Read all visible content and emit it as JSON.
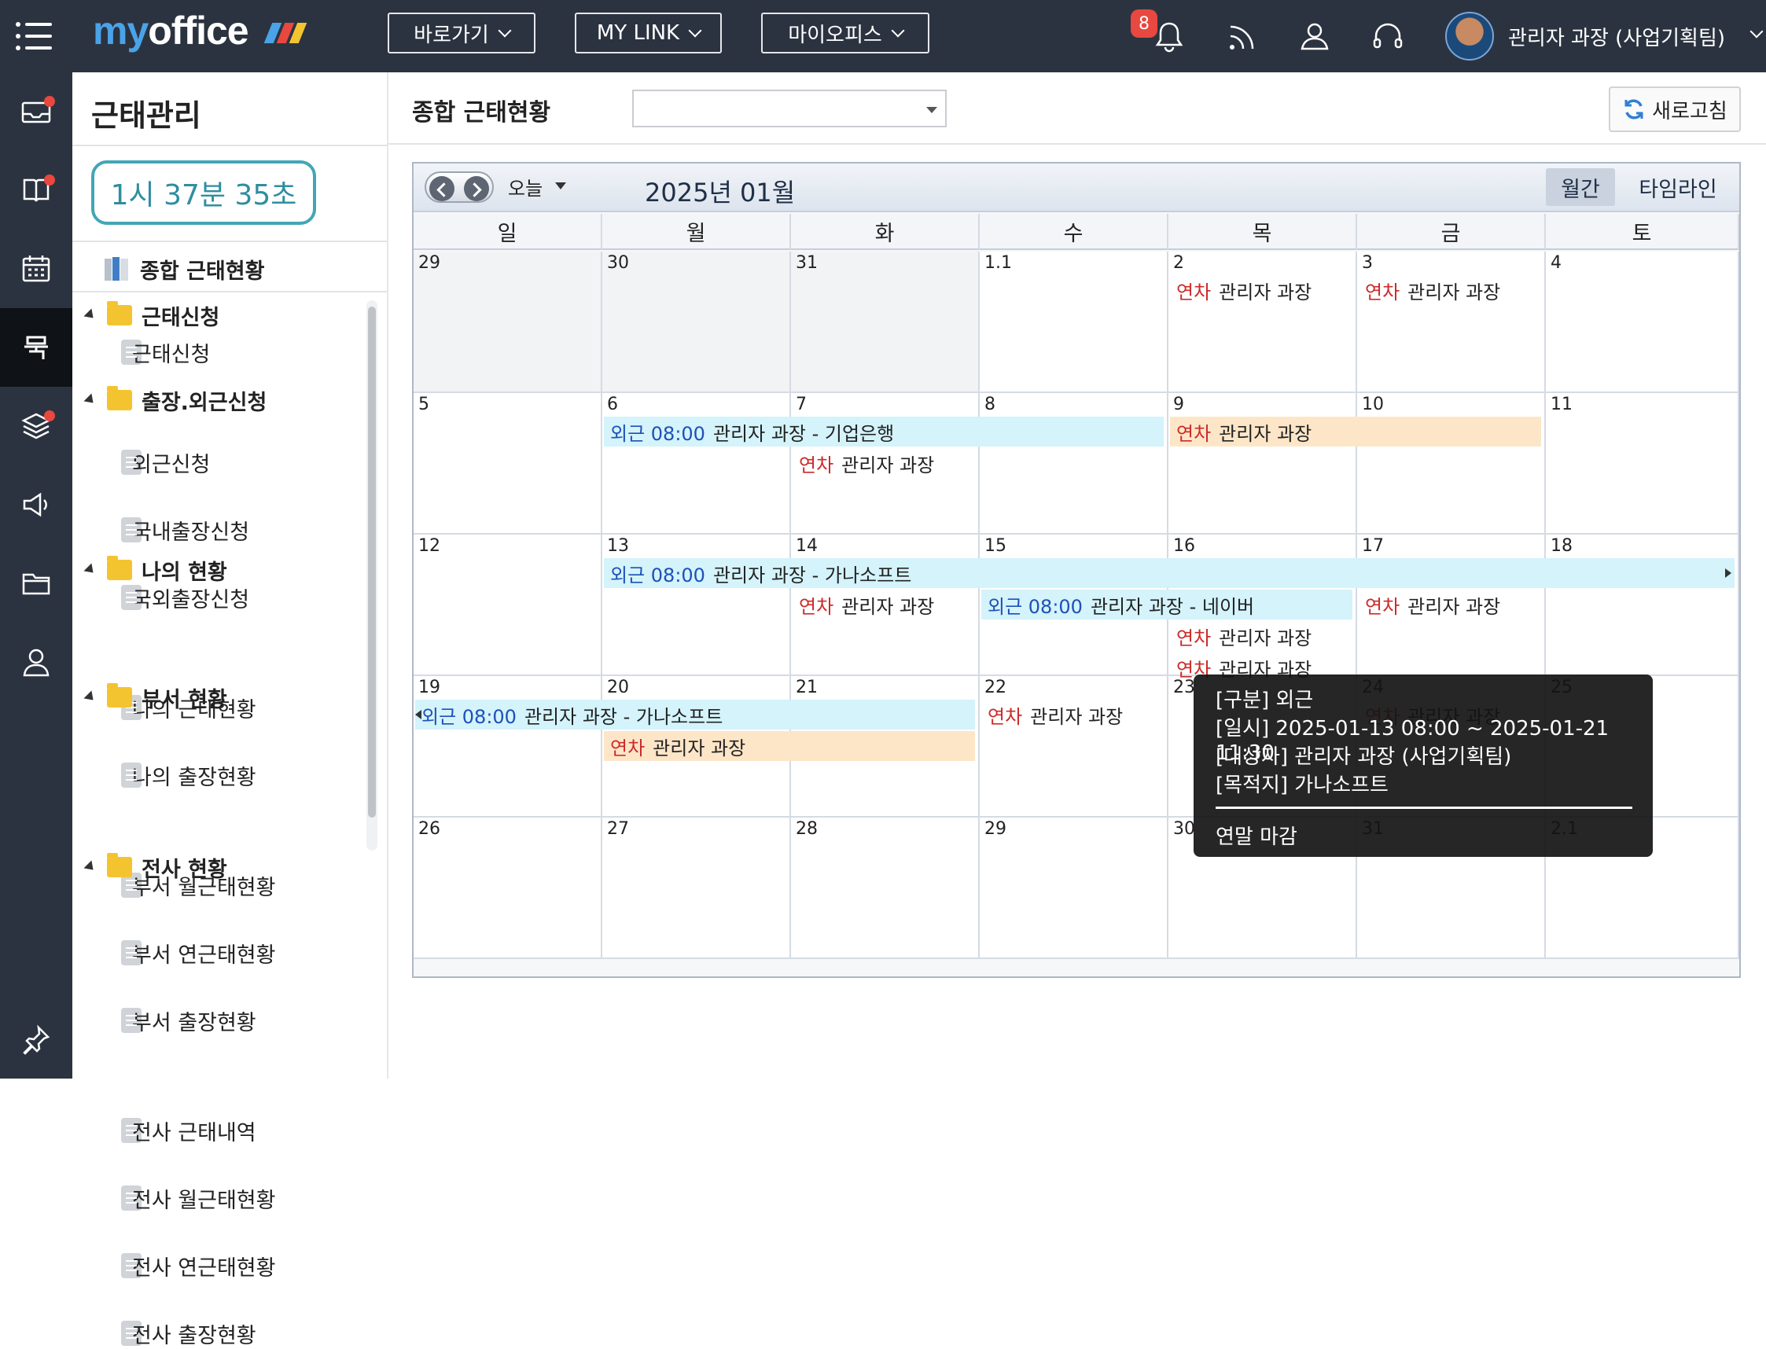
{
  "topbar": {
    "logo_my": "my",
    "logo_office": "office",
    "menu_goto": "바로가기",
    "menu_mylink": "MY LINK",
    "menu_myoffice": "마이오피스",
    "notification_count": "8",
    "user_name": "관리자 과장 (사업기획팀)"
  },
  "rail": {
    "icons": [
      "inbox-icon",
      "book-icon",
      "calendar-icon",
      "attendance-icon",
      "layers-icon",
      "speaker-icon",
      "folder-icon",
      "user-icon",
      "pin-icon"
    ]
  },
  "sidebar": {
    "title": "근태관리",
    "timer": "1시 37분 35초",
    "summary_label": "종합 근태현황",
    "tree": [
      {
        "kind": "folder",
        "label": "근태신청"
      },
      {
        "kind": "doc",
        "label": "근태신청"
      },
      {
        "kind": "folder",
        "label": "출장.외근신청"
      },
      {
        "kind": "doc",
        "label": "외근신청"
      },
      {
        "kind": "doc",
        "label": "국내출장신청"
      },
      {
        "kind": "doc",
        "label": "국외출장신청"
      },
      {
        "kind": "folder",
        "label": "나의 현황"
      },
      {
        "kind": "doc",
        "label": "나의 근태현황"
      },
      {
        "kind": "doc",
        "label": "나의 출장현황"
      },
      {
        "kind": "folder",
        "label": "부서 현황"
      },
      {
        "kind": "doc",
        "label": "부서 월근태현황"
      },
      {
        "kind": "doc",
        "label": "부서 연근태현황"
      },
      {
        "kind": "doc",
        "label": "부서 출장현황"
      },
      {
        "kind": "folder",
        "label": "전사 현황"
      },
      {
        "kind": "doc",
        "label": "전사 근태내역"
      },
      {
        "kind": "doc",
        "label": "전사 월근태현황"
      },
      {
        "kind": "doc",
        "label": "전사 연근태현황"
      },
      {
        "kind": "doc",
        "label": "전사 출장현황"
      }
    ]
  },
  "main": {
    "title": "종합 근태현황",
    "select_value": "",
    "refresh_label": "새로고침"
  },
  "calendar": {
    "today_label": "오늘",
    "month_label": "2025년 01월",
    "view_monthly": "월간",
    "view_timeline": "타임라인",
    "weekdays": [
      "일",
      "월",
      "화",
      "수",
      "목",
      "금",
      "토"
    ],
    "weeks": [
      [
        {
          "d": "29",
          "other": true
        },
        {
          "d": "30",
          "other": true
        },
        {
          "d": "31",
          "other": true
        },
        {
          "d": "1.1"
        },
        {
          "d": "2"
        },
        {
          "d": "3"
        },
        {
          "d": "4"
        }
      ],
      [
        {
          "d": "5"
        },
        {
          "d": "6"
        },
        {
          "d": "7"
        },
        {
          "d": "8"
        },
        {
          "d": "9"
        },
        {
          "d": "10"
        },
        {
          "d": "11"
        }
      ],
      [
        {
          "d": "12"
        },
        {
          "d": "13"
        },
        {
          "d": "14"
        },
        {
          "d": "15"
        },
        {
          "d": "16"
        },
        {
          "d": "17"
        },
        {
          "d": "18"
        }
      ],
      [
        {
          "d": "19"
        },
        {
          "d": "20"
        },
        {
          "d": "21"
        },
        {
          "d": "22"
        },
        {
          "d": "23"
        },
        {
          "d": "24"
        },
        {
          "d": "25"
        }
      ],
      [
        {
          "d": "26"
        },
        {
          "d": "27"
        },
        {
          "d": "28"
        },
        {
          "d": "29"
        },
        {
          "d": "30"
        },
        {
          "d": "31"
        },
        {
          "d": "2.1"
        }
      ]
    ],
    "events": [
      {
        "week": 0,
        "start": 4,
        "span": 1,
        "lane": 0,
        "kind": "leave",
        "bg": "none",
        "type": "연차",
        "text": "관리자 과장"
      },
      {
        "week": 0,
        "start": 5,
        "span": 1,
        "lane": 0,
        "kind": "leave",
        "bg": "none",
        "type": "연차",
        "text": "관리자 과장"
      },
      {
        "week": 1,
        "start": 1,
        "span": 3,
        "lane": 0,
        "kind": "out",
        "bg": "blue",
        "type": "외근 08:00",
        "text": "관리자 과장 - 기업은행"
      },
      {
        "week": 1,
        "start": 4,
        "span": 2,
        "lane": 0,
        "kind": "leave",
        "bg": "orange",
        "type": "연차",
        "text": "관리자 과장"
      },
      {
        "week": 1,
        "start": 2,
        "span": 1,
        "lane": 1,
        "kind": "leave",
        "bg": "none",
        "type": "연차",
        "text": "관리자 과장"
      },
      {
        "week": 2,
        "start": 1,
        "span": 6,
        "lane": 0,
        "kind": "out",
        "bg": "blue",
        "type": "외근 08:00",
        "text": "관리자 과장 - 가나소프트",
        "arrow": "right"
      },
      {
        "week": 2,
        "start": 2,
        "span": 1,
        "lane": 1,
        "kind": "leave",
        "bg": "none",
        "type": "연차",
        "text": "관리자 과장"
      },
      {
        "week": 2,
        "start": 3,
        "span": 2,
        "lane": 1,
        "kind": "out",
        "bg": "blue",
        "type": "외근 08:00",
        "text": "관리자 과장 - 네이버"
      },
      {
        "week": 2,
        "start": 5,
        "span": 1,
        "lane": 1,
        "kind": "leave",
        "bg": "none",
        "type": "연차",
        "text": "관리자 과장"
      },
      {
        "week": 2,
        "start": 4,
        "span": 1,
        "lane": 2,
        "kind": "leave",
        "bg": "none",
        "type": "연차",
        "text": "관리자 과장"
      },
      {
        "week": 2,
        "start": 4,
        "span": 1,
        "lane": 3,
        "kind": "leave",
        "bg": "none",
        "type": "연차",
        "text": "관리자 과장"
      },
      {
        "week": 3,
        "start": 0,
        "span": 3,
        "lane": 0,
        "kind": "out",
        "bg": "blue",
        "type": "외근 08:00",
        "text": "관리자 과장 - 가나소프트",
        "arrow": "left"
      },
      {
        "week": 3,
        "start": 1,
        "span": 2,
        "lane": 1,
        "kind": "leave",
        "bg": "orange",
        "type": "연차",
        "text": "관리자 과장"
      },
      {
        "week": 3,
        "start": 3,
        "span": 1,
        "lane": 0,
        "kind": "leave",
        "bg": "none",
        "type": "연차",
        "text": "관리자 과장"
      },
      {
        "week": 3,
        "start": 5,
        "span": 1,
        "lane": 0,
        "kind": "leave",
        "bg": "none",
        "type": "연차",
        "text": "관리자 과장"
      }
    ]
  },
  "tooltip": {
    "line_type": "[구분] 외근",
    "line_date": "[일시] 2025-01-13 08:00 ~ 2025-01-21 11:30",
    "line_target": "[대상자] 관리자 과장 (사업기획팀)",
    "line_dest": "[목적지] 가나소프트",
    "footer": "연말 마감"
  }
}
